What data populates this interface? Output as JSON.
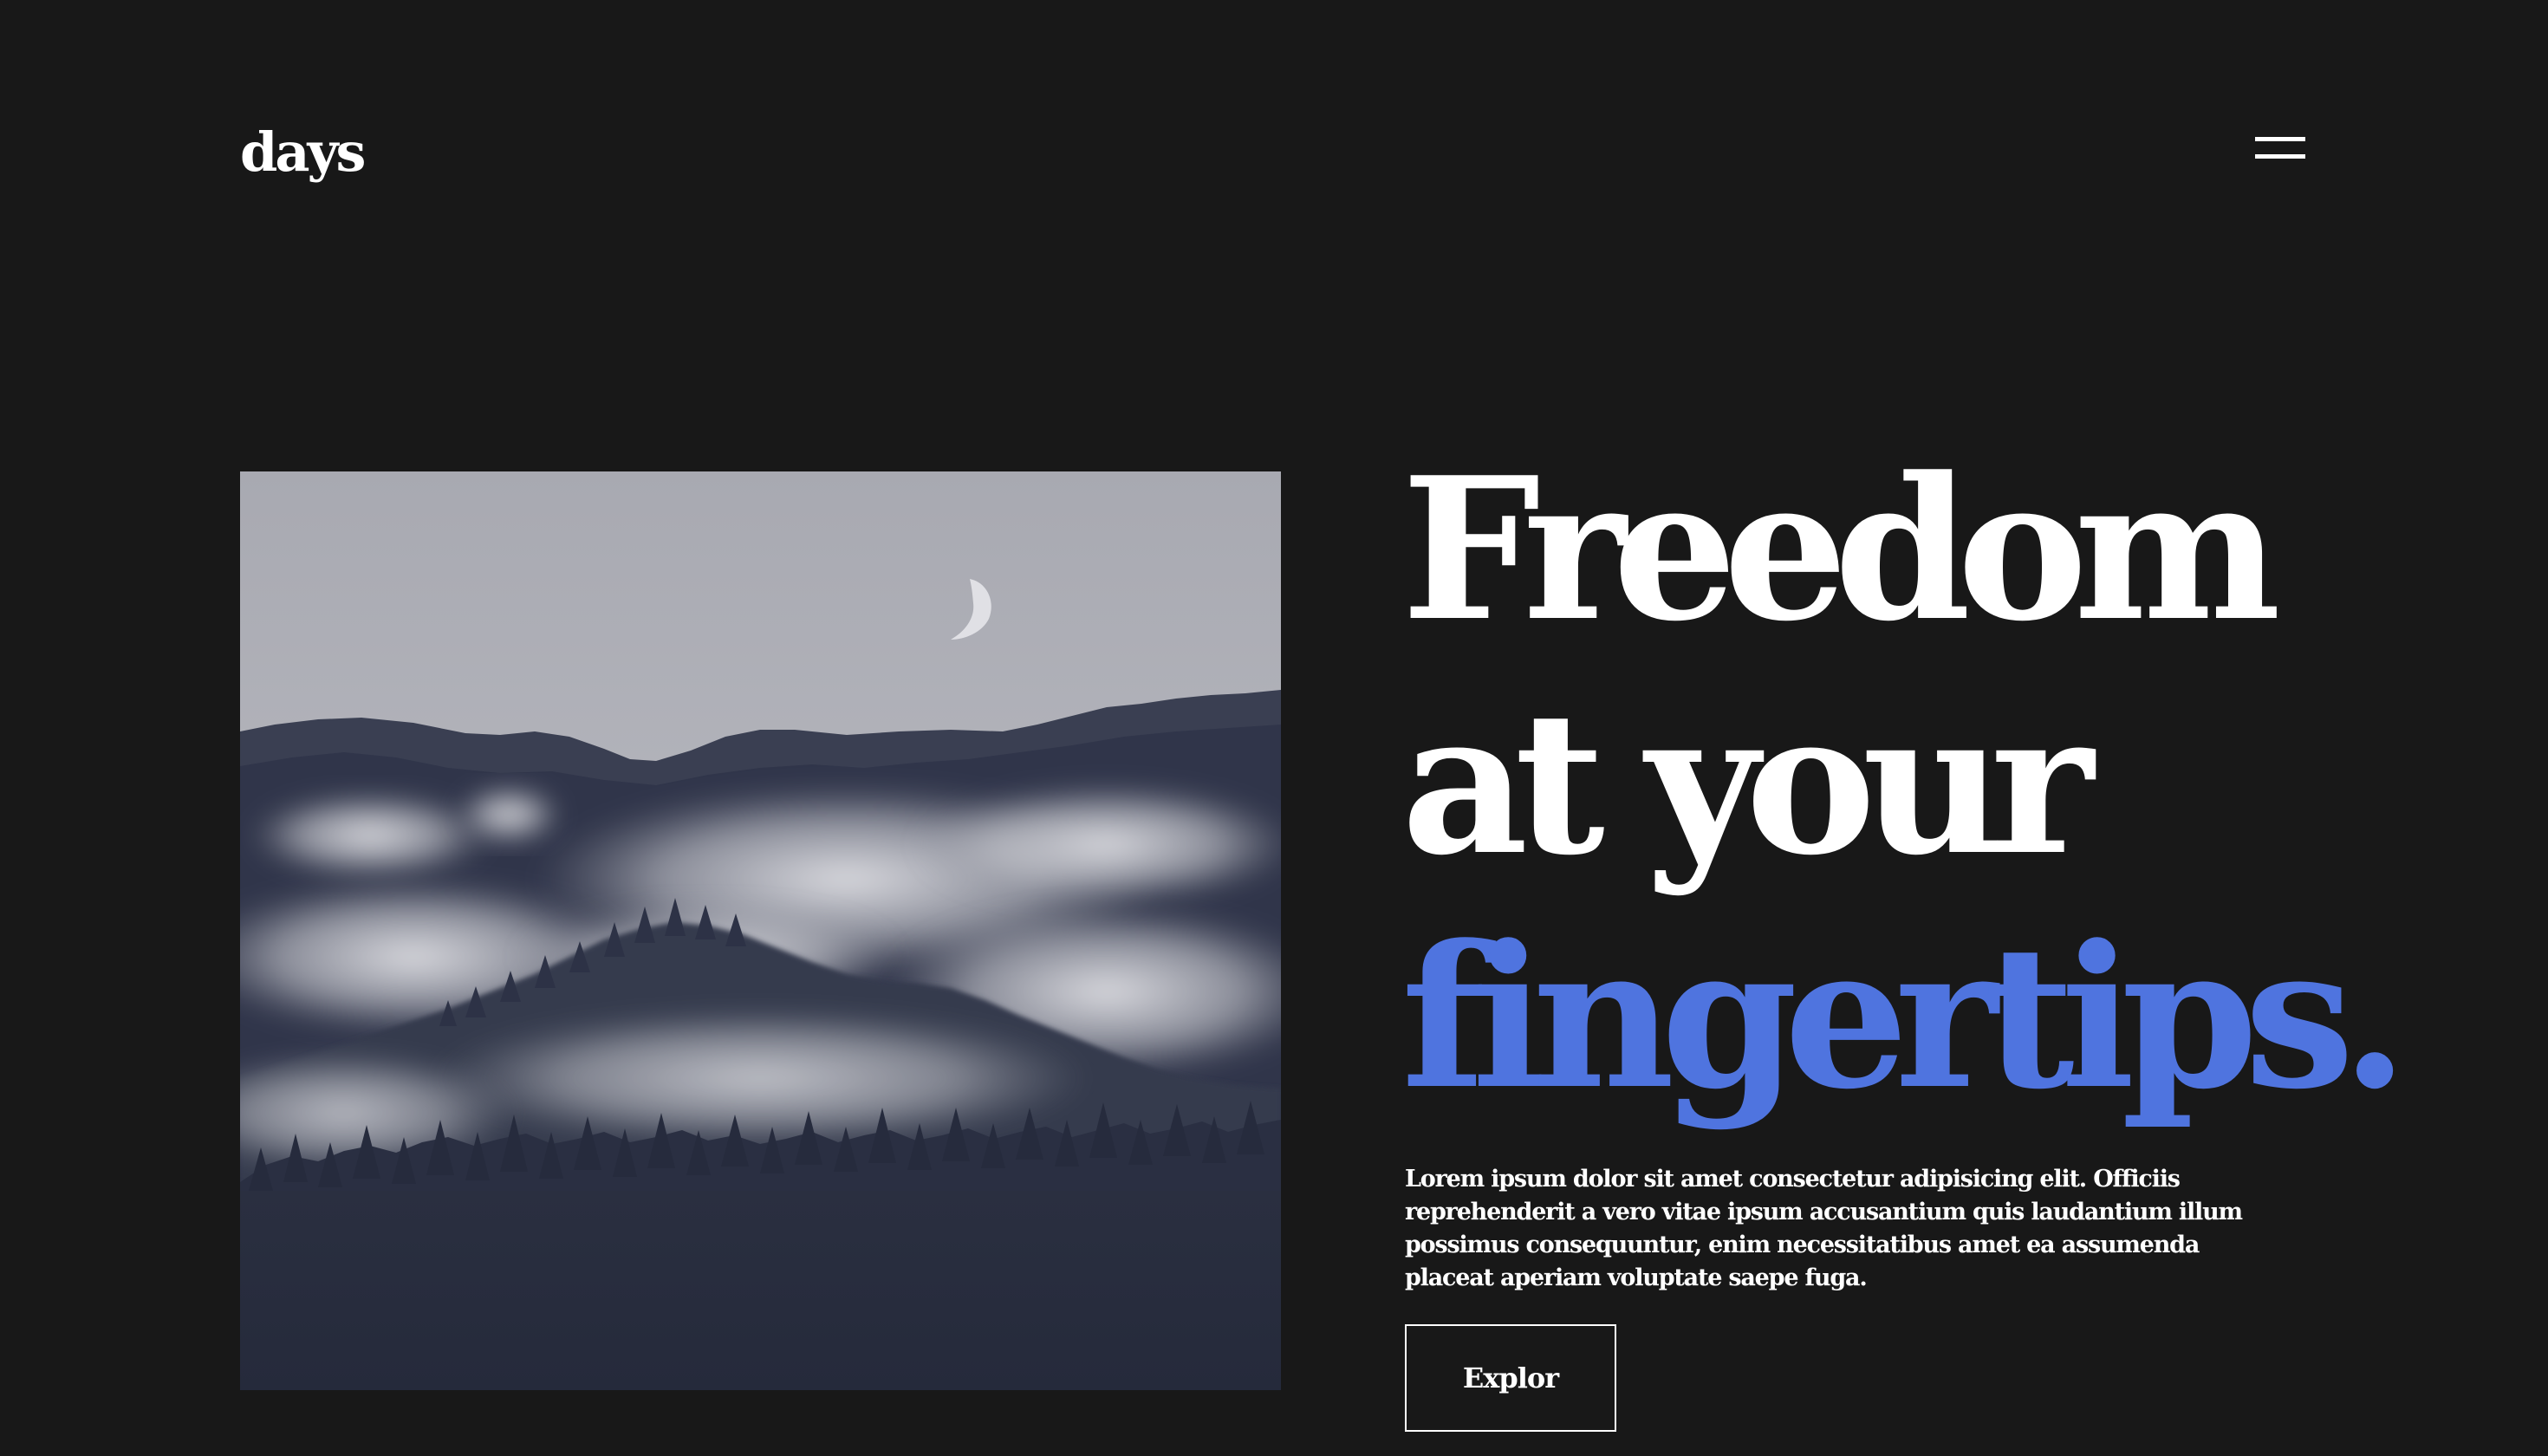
{
  "header": {
    "logo": "days",
    "menu_icon": "hamburger-menu-icon"
  },
  "hero": {
    "image_subject": "misty-forest-mountains-with-moon",
    "headline": {
      "line1": "Freedom",
      "line2": "at your",
      "line3": "fingertips."
    },
    "description": "Lorem ipsum dolor sit amet consectetur adipisicing elit. Officiis reprehenderit a vero vitae ipsum accusantium quis laudantium illum possimus consequuntur, enim necessitatibus amet ea assumenda placeat aperiam voluptate saepe fuga.",
    "cta_label": "Explor"
  },
  "colors": {
    "background": "#181818",
    "text": "#ffffff",
    "accent": "#4f74df",
    "image_sky": "#a9abb3",
    "image_forest": "#252a3a"
  }
}
